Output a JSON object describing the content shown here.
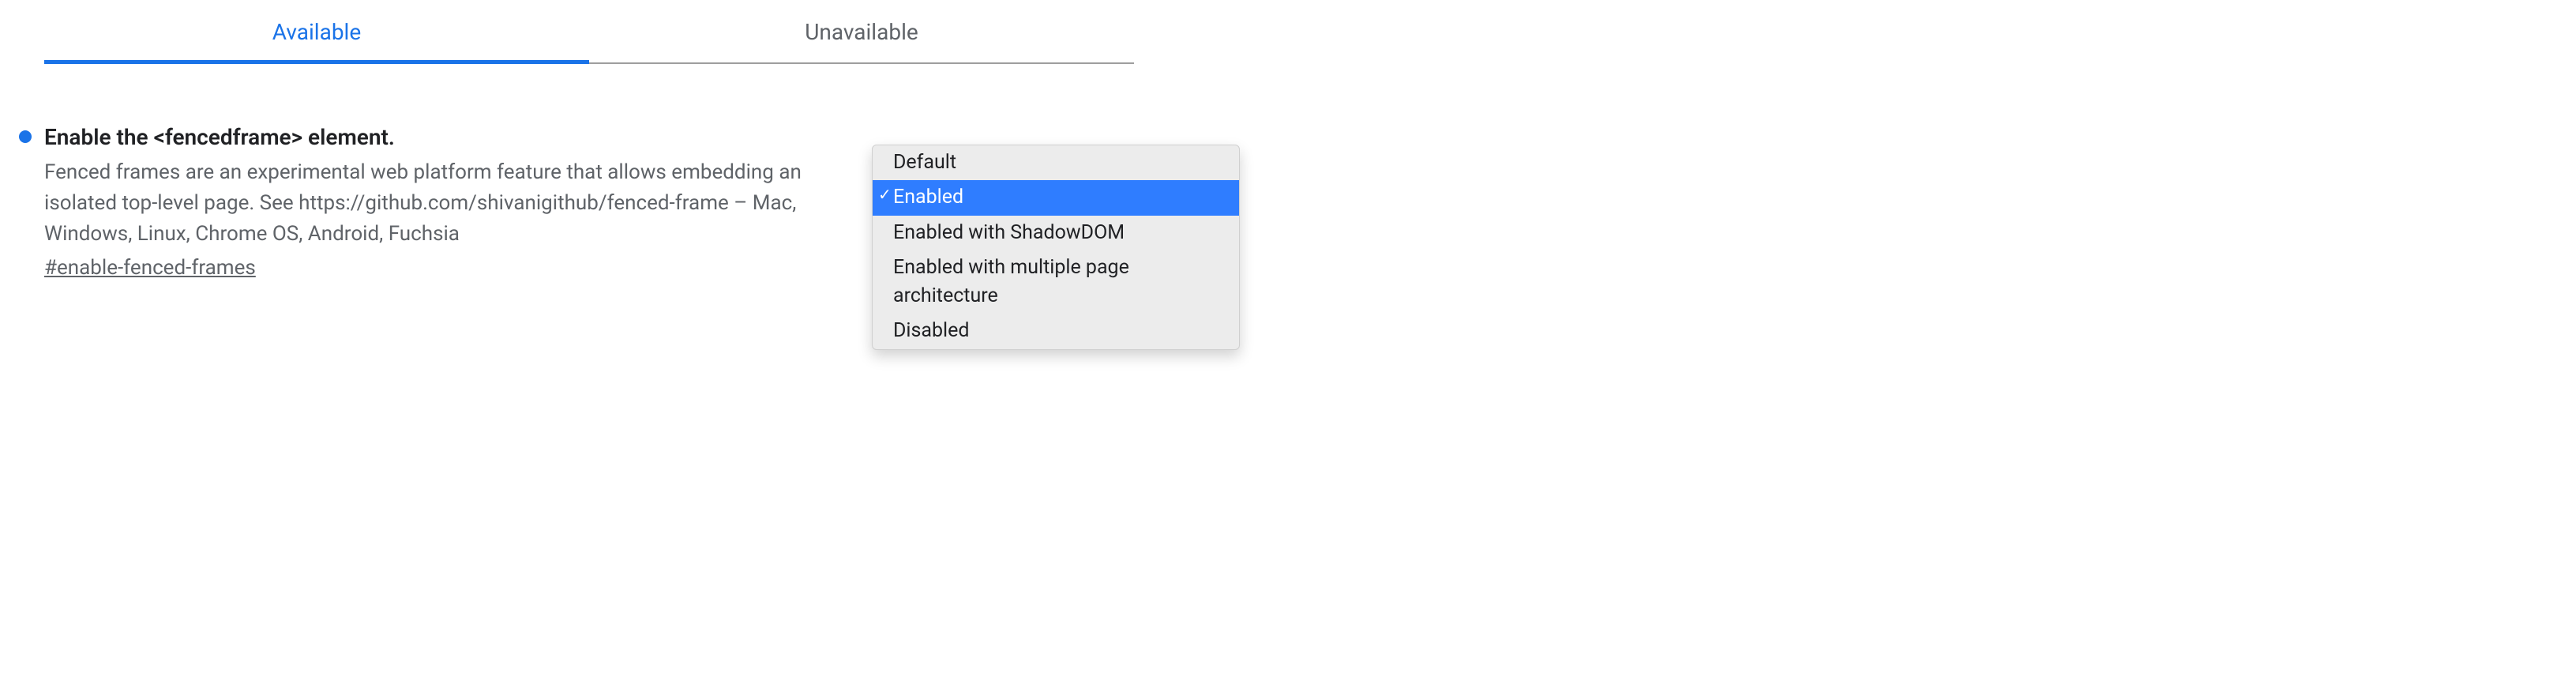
{
  "tabs": {
    "available": "Available",
    "unavailable": "Unavailable"
  },
  "flag": {
    "title": "Enable the <fencedframe> element.",
    "description": "Fenced frames are an experimental web platform feature that allows embedding an isolated top-level page. See https://github.com/shivanigithub/fenced-frame – Mac, Windows, Linux, Chrome OS, Android, Fuchsia",
    "hash": "#enable-fenced-frames",
    "dot_color": "#1a73e8"
  },
  "dropdown": {
    "options": [
      "Default",
      "Enabled",
      "Enabled with ShadowDOM",
      "Enabled with multiple page architecture",
      "Disabled"
    ],
    "selected_index": 1
  }
}
